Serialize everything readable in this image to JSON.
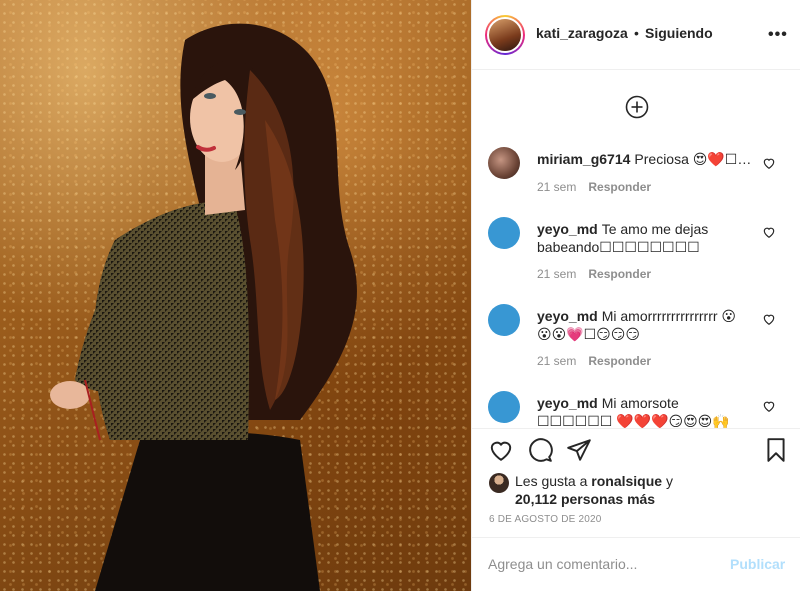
{
  "header": {
    "username": "kati_zaragoza",
    "separator": "•",
    "follow_status": "Siguiendo",
    "more_label": "•••"
  },
  "comments": [
    {
      "user": "miriam_g6714",
      "text": "Preciosa 😍❤️☐…",
      "time": "21 sem",
      "reply_label": "Responder",
      "avatar": "photo"
    },
    {
      "user": "yeyo_md",
      "text": "Te amo me dejas babeando☐☐☐☐☐☐☐☐",
      "time": "21 sem",
      "reply_label": "Responder",
      "avatar": "default"
    },
    {
      "user": "yeyo_md",
      "text": "Mi amorrrrrrrrrrrrrrr 😮 😮😮💗☐😏😏😏",
      "time": "21 sem",
      "reply_label": "Responder",
      "avatar": "default"
    },
    {
      "user": "yeyo_md",
      "text": "Mi amorsote ☐☐☐☐☐☐ ❤️❤️❤️😏😍😍🙌",
      "time": "",
      "reply_label": "",
      "avatar": "default"
    }
  ],
  "likes": {
    "prefix": "Les gusta a",
    "user": "ronalsique",
    "conjunction": "y",
    "count_text": "20,112 personas más"
  },
  "date": "6 DE AGOSTO DE 2020",
  "add_comment": {
    "placeholder": "Agrega un comentario...",
    "post_label": "Publicar"
  },
  "icons": {
    "load_more": "plus-circle-icon",
    "like": "heart-icon",
    "comment": "comment-icon",
    "share": "paper-plane-icon",
    "save": "bookmark-icon"
  },
  "colors": {
    "accent": "#3897d3",
    "post_disabled": "#b2dffc",
    "meta_gray": "#8e8e8e",
    "text": "#262626"
  }
}
